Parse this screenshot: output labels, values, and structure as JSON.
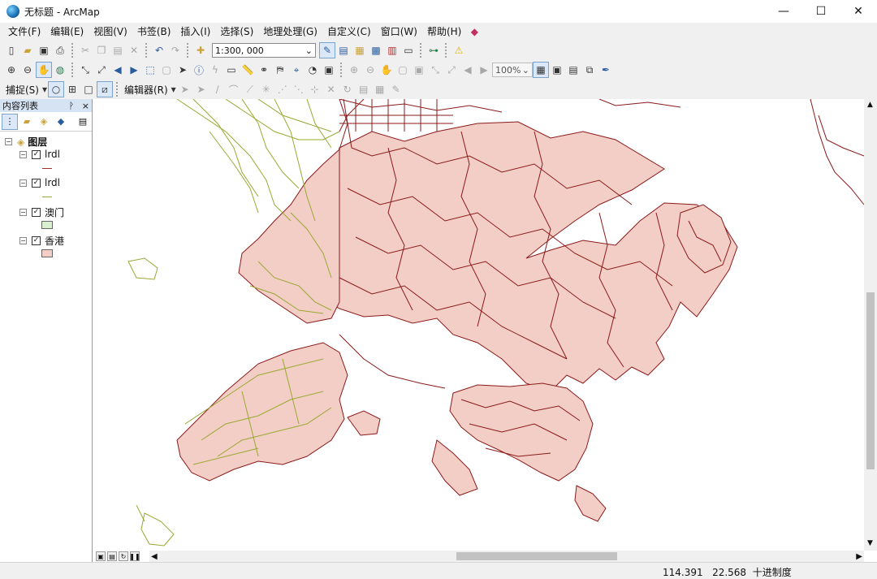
{
  "window": {
    "title": "无标题 - ArcMap",
    "minimize": "—",
    "maximize": "☐",
    "close": "✕"
  },
  "menu": [
    "文件(F)",
    "编辑(E)",
    "视图(V)",
    "书签(B)",
    "插入(I)",
    "选择(S)",
    "地理处理(G)",
    "自定义(C)",
    "窗口(W)",
    "帮助(H)"
  ],
  "toolbar": {
    "scale": "1:300, 000",
    "zoom_percent": "100%",
    "snapping_label": "捕捉(S)",
    "editor_label": "编辑器(R)"
  },
  "toc": {
    "title": "内容列表",
    "pin": "ᚹ",
    "close": "×",
    "group_name": "图层",
    "layers": [
      {
        "name": "lrdl",
        "color": "#a0302a",
        "kind": "line"
      },
      {
        "name": "lrdl",
        "color": "#9aa832",
        "kind": "line"
      },
      {
        "name": "澳门",
        "color": "#d9f0cf",
        "kind": "polygon"
      },
      {
        "name": "香港",
        "color": "#f2cec6",
        "kind": "polygon"
      }
    ]
  },
  "map": {
    "hk_fill": "#f2cec6",
    "hk_outline": "#8b1a1a",
    "hk_road": "#8b1a1a",
    "green_road": "#9aa832"
  },
  "status": {
    "x": "114.391",
    "y": "22.568",
    "units": "十进制度"
  }
}
